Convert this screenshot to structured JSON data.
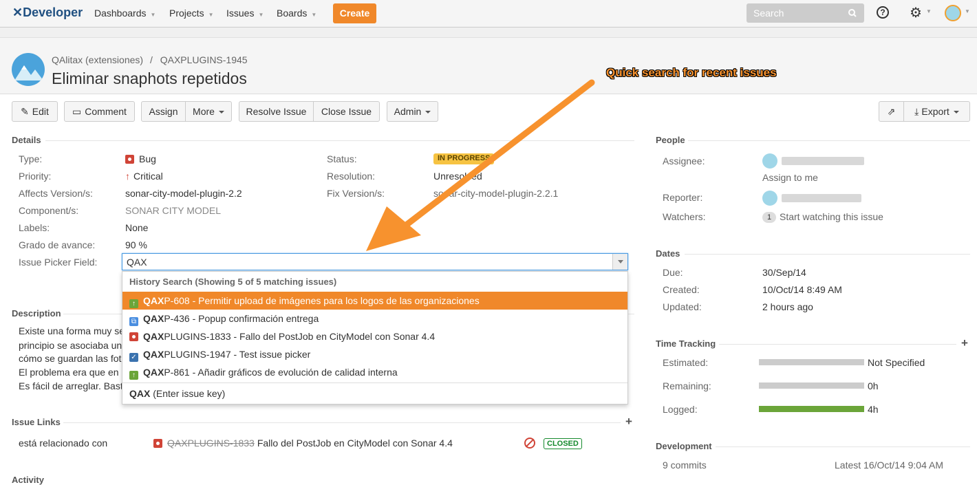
{
  "nav": {
    "logo": "Developer",
    "items": [
      "Dashboards",
      "Projects",
      "Issues",
      "Boards"
    ],
    "create": "Create",
    "search_placeholder": "Search"
  },
  "breadcrumb": {
    "project": "QAlitax (extensiones)",
    "sep": "/",
    "key": "QAXPLUGINS-1945"
  },
  "issue_title": "Eliminar snaphots repetidos",
  "annotation": "Quick search for recent issues",
  "toolbar": {
    "edit": "Edit",
    "comment": "Comment",
    "assign": "Assign",
    "more": "More",
    "resolve": "Resolve Issue",
    "close": "Close Issue",
    "admin": "Admin",
    "export": "Export"
  },
  "details": {
    "title": "Details",
    "type_label": "Type:",
    "type": "Bug",
    "priority_label": "Priority:",
    "priority": "Critical",
    "affects_label": "Affects Version/s:",
    "affects": "sonar-city-model-plugin-2.2",
    "component_label": "Component/s:",
    "component": "SONAR CITY MODEL",
    "labels_label": "Labels:",
    "labels": "None",
    "grado_label": "Grado de avance:",
    "grado": "90 %",
    "picker_label": "Issue Picker Field:",
    "picker_value": "QAX",
    "status_label": "Status:",
    "status": "IN PROGRESS",
    "resolution_label": "Resolution:",
    "resolution": "Unresolved",
    "fix_label": "Fix Version/s:",
    "fix": "sonar-city-model-plugin-2.2.1"
  },
  "dropdown": {
    "header": "History Search (Showing 5 of 5 matching issues)",
    "items": [
      {
        "bold": "QAX",
        "rest": "P-608 - Permitir upload de imágenes para los logos de las organizaciones",
        "icon": "improvement-icon",
        "color": "#6ba539"
      },
      {
        "bold": "QAX",
        "rest": "P-436 - Popup confirmación entrega",
        "icon": "subtask-icon",
        "color": "#4a8ee0"
      },
      {
        "bold": "QAX",
        "rest": "PLUGINS-1833 - Fallo del PostJob en CityModel con Sonar 4.4",
        "icon": "bug-icon",
        "color": "#d04437"
      },
      {
        "bold": "QAX",
        "rest": "PLUGINS-1947 - Test issue picker",
        "icon": "task-icon",
        "color": "#3b73af"
      },
      {
        "bold": "QAX",
        "rest": "P-861 - Añadir gráficos de evolución de calidad interna",
        "icon": "improvement-icon",
        "color": "#6ba539"
      }
    ],
    "footer_bold": "QAX",
    "footer_rest": " (Enter issue key)"
  },
  "description": {
    "title": "Description",
    "lines": [
      "Existe una forma muy se",
      "principio se asociaba un",
      "cómo se guardan las fot",
      "El problema era que en",
      "Es fácil de arreglar. Bast"
    ]
  },
  "links": {
    "title": "Issue Links",
    "relation": "está relacionado con",
    "key": "QAXPLUGINS-1833",
    "summary": "Fallo del PostJob en CityModel con Sonar 4.4",
    "status": "CLOSED"
  },
  "activity": {
    "title": "Activity"
  },
  "people": {
    "title": "People",
    "assignee_label": "Assignee:",
    "assign_me": "Assign to me",
    "reporter_label": "Reporter:",
    "watchers_label": "Watchers:",
    "watch_count": "1",
    "watch_text": "Start watching this issue"
  },
  "dates": {
    "title": "Dates",
    "due_label": "Due:",
    "due": "30/Sep/14",
    "created_label": "Created:",
    "created": "10/Oct/14 8:49 AM",
    "updated_label": "Updated:",
    "updated": "2 hours ago"
  },
  "time": {
    "title": "Time Tracking",
    "estimated_label": "Estimated:",
    "estimated": "Not Specified",
    "estimated_fill": 0,
    "remaining_label": "Remaining:",
    "remaining": "0h",
    "remaining_fill": 0,
    "logged_label": "Logged:",
    "logged": "4h",
    "logged_fill": 1
  },
  "development": {
    "title": "Development",
    "commits": "9 commits",
    "latest": "Latest 16/Oct/14 9:04 AM"
  },
  "colors": {
    "accent": "#f0882a",
    "brand": "#205081",
    "progress": "#f6c342",
    "logged": "#6ba539"
  }
}
